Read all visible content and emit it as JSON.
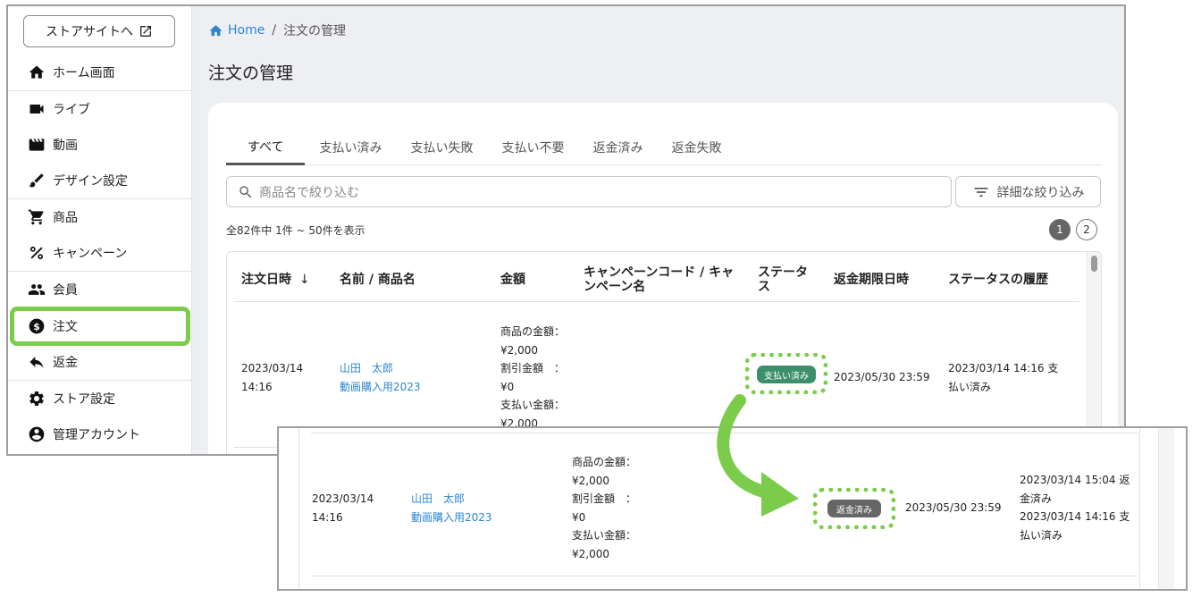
{
  "sidebar": {
    "store_button": "ストアサイトへ",
    "items": [
      {
        "label": "ホーム画面",
        "icon": "home-icon"
      },
      {
        "label": "ライブ",
        "icon": "video-camera-icon"
      },
      {
        "label": "動画",
        "icon": "clapperboard-icon"
      },
      {
        "label": "デザイン設定",
        "icon": "brush-icon"
      },
      {
        "label": "商品",
        "icon": "cart-icon"
      },
      {
        "label": "キャンペーン",
        "icon": "percent-icon"
      },
      {
        "label": "会員",
        "icon": "people-icon"
      },
      {
        "label": "注文",
        "icon": "dollar-icon"
      },
      {
        "label": "返金",
        "icon": "reply-icon"
      },
      {
        "label": "ストア設定",
        "icon": "gear-icon"
      },
      {
        "label": "管理アカウント",
        "icon": "account-circle-icon"
      }
    ],
    "active_index": 7
  },
  "breadcrumb": {
    "home": "Home",
    "separator": "/",
    "current": "注文の管理"
  },
  "page_title": "注文の管理",
  "tabs": [
    "すべて",
    "支払い済み",
    "支払い失敗",
    "支払い不要",
    "返金済み",
    "返金失敗"
  ],
  "active_tab": 0,
  "search": {
    "placeholder": "商品名で絞り込む"
  },
  "filter_button": "詳細な絞り込み",
  "count_text": "全82件中 1件 ~ 50件を表示",
  "pagination": {
    "pages": [
      "1",
      "2"
    ],
    "current": "1"
  },
  "table": {
    "headers": {
      "date": "注文日時",
      "sort_arrow": "↓",
      "name": "名前 / 商品名",
      "amount": "金額",
      "campaign_1": "キャンペーンコード / キャ",
      "campaign_2": "ンペーン名",
      "status_1": "ステータ",
      "status_2": "ス",
      "refund_deadline": "返金期限日時",
      "history": "ステータスの履歴"
    },
    "row": {
      "date_1": "2023/03/14",
      "date_2": "14:16",
      "customer": "山田　太郎",
      "product": "動画購入用2023",
      "amount_lines": [
        "商品の金額：",
        "¥2,000",
        "割引金額　：",
        "¥0",
        "支払い金額：",
        "¥2,000"
      ],
      "status": "支払い済み",
      "refund_deadline": "2023/05/30 23:59",
      "history_lines": [
        "2023/03/14 14:16 支",
        "払い済み"
      ]
    }
  },
  "overlay_row": {
    "date_1": "2023/03/14",
    "date_2": "14:16",
    "customer": "山田　太郎",
    "product": "動画購入用2023",
    "amount_lines": [
      "商品の金額：",
      "¥2,000",
      "割引金額　：",
      "¥0",
      "支払い金額：",
      "¥2,000"
    ],
    "status": "返金済み",
    "refund_deadline": "2023/05/30 23:59",
    "history_lines": [
      "2023/03/14 15:04 返",
      "金済み",
      "2023/03/14 14:16 支",
      "払い済み"
    ]
  },
  "colors": {
    "highlight": "#7ccc4c",
    "link": "#2a86d1",
    "paid_badge": "#3d8f6c",
    "refunded_badge": "#666666"
  }
}
